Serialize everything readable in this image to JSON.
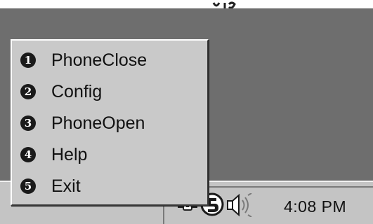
{
  "menu": {
    "items": [
      {
        "number": "1",
        "label": "PhoneClose"
      },
      {
        "number": "2",
        "label": "Config"
      },
      {
        "number": "3",
        "label": "PhoneOpen"
      },
      {
        "number": "4",
        "label": "Help"
      },
      {
        "number": "5",
        "label": "Exit"
      }
    ]
  },
  "tray": {
    "time": "4:08 PM",
    "icons": [
      "network-icon",
      "phone-app-icon",
      "speaker-icon"
    ]
  },
  "colors": {
    "desktop": "#6e6e6e",
    "taskbar": "#c4c4c4",
    "menu": "#c9c9c9",
    "number_badge": "#1a1a1a"
  }
}
